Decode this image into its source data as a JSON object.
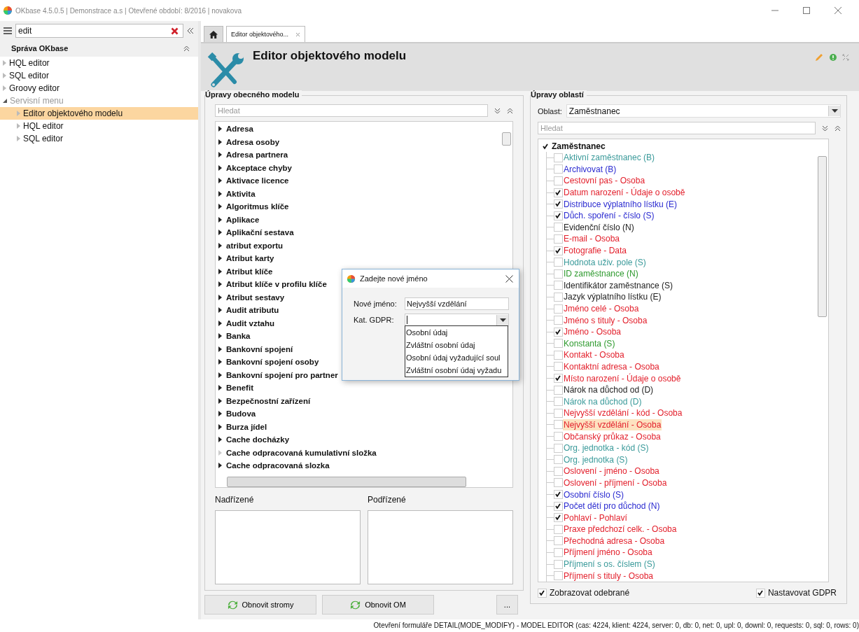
{
  "window": {
    "title": "OKbase 4.5.0.5 | Demonstrace a.s | Otevřené období: 8/2016 | novakova"
  },
  "sidebar": {
    "search": {
      "value": "edit"
    },
    "section": "Správa OKbase",
    "items": [
      {
        "label": "HQL editor",
        "expanded": false,
        "selected": false,
        "disabled": false
      },
      {
        "label": "SQL editor",
        "expanded": false,
        "selected": false,
        "disabled": false
      },
      {
        "label": "Groovy editor",
        "expanded": false,
        "selected": false,
        "disabled": false
      },
      {
        "label": "Servisní menu",
        "expanded": true,
        "selected": false,
        "disabled": true,
        "children": [
          {
            "label": "Editor objektového modelu",
            "expanded": false,
            "selected": true,
            "disabled": false
          },
          {
            "label": "HQL editor",
            "expanded": false,
            "selected": false,
            "disabled": false
          },
          {
            "label": "SQL editor",
            "expanded": false,
            "selected": false,
            "disabled": false
          }
        ]
      }
    ]
  },
  "tabs": [
    {
      "kind": "home",
      "selected": false
    },
    {
      "kind": "text",
      "label": "Editor objektového...",
      "selected": true
    }
  ],
  "header": {
    "title": "Editor objektového modelu"
  },
  "general_model": {
    "legend": "Úpravy obecného modelu",
    "search": {
      "placeholder": "Hledat"
    },
    "entities": [
      {
        "label": "Adresa",
        "has_children": true
      },
      {
        "label": "Adresa osoby",
        "has_children": true
      },
      {
        "label": "Adresa partnera",
        "has_children": true
      },
      {
        "label": "Akceptace chyby",
        "has_children": true
      },
      {
        "label": "Aktivace licence",
        "has_children": true
      },
      {
        "label": "Aktivita",
        "has_children": true
      },
      {
        "label": "Algoritmus klíče",
        "has_children": true
      },
      {
        "label": "Aplikace",
        "has_children": true
      },
      {
        "label": "Aplikační sestava",
        "has_children": true
      },
      {
        "label": "atribut exportu",
        "has_children": true
      },
      {
        "label": "Atribut karty",
        "has_children": true
      },
      {
        "label": "Atribut klíče",
        "has_children": true
      },
      {
        "label": "Atribut klíče v profilu klíče",
        "has_children": true
      },
      {
        "label": "Atribut sestavy",
        "has_children": true
      },
      {
        "label": "Audit atributu",
        "has_children": true
      },
      {
        "label": "Audit vztahu",
        "has_children": true
      },
      {
        "label": "Banka",
        "has_children": true
      },
      {
        "label": "Bankovní spojení",
        "has_children": true
      },
      {
        "label": "Bankovní spojení osoby",
        "has_children": true
      },
      {
        "label": "Bankovní spojení pro partner",
        "has_children": true
      },
      {
        "label": "Benefit",
        "has_children": true
      },
      {
        "label": "Bezpečnostní zařízení",
        "has_children": true
      },
      {
        "label": "Budova",
        "has_children": true
      },
      {
        "label": "Burza jídel",
        "has_children": true
      },
      {
        "label": "Cache docházky",
        "has_children": true
      },
      {
        "label": "Cache odpracovaná kumulativní složka",
        "has_children": false
      },
      {
        "label": "Cache odpracovaná slozka",
        "has_children": true
      }
    ],
    "parents_label": "Nadřízené",
    "children_label": "Podřízené"
  },
  "buttons": [
    {
      "kind": "refresh",
      "label": "Obnovit stromy"
    },
    {
      "kind": "refresh",
      "label": "Obnovit OM"
    },
    {
      "kind": "plain",
      "label": "..."
    }
  ],
  "areas": {
    "legend": "Úpravy oblastí",
    "area_label": "Oblast:",
    "area_value": "Zaměstnanec",
    "search": {
      "placeholder": "Hledat"
    },
    "root": {
      "label": "Zaměstnanec",
      "checked": true,
      "children": [
        {
          "label": "Aktivní zaměstnanec (B)",
          "checked": false,
          "selected": false,
          "color": "#3a9a9a"
        },
        {
          "label": "Archivovat (B)",
          "checked": false,
          "selected": false,
          "color": "#2a2ad0"
        },
        {
          "label": "Cestovní pas - Osoba",
          "checked": false,
          "selected": false,
          "color": "#e3202c"
        },
        {
          "label": "Datum narození - Údaje o osobě",
          "checked": true,
          "selected": false,
          "color": "#e3202c"
        },
        {
          "label": "Distribuce výplatního lístku (E)",
          "checked": true,
          "selected": false,
          "color": "#2a2ad0"
        },
        {
          "label": "Důch. spoření - číslo (S)",
          "checked": true,
          "selected": false,
          "color": "#2a2ad0"
        },
        {
          "label": "Evidenční číslo (N)",
          "checked": false,
          "selected": false,
          "color": "#222222"
        },
        {
          "label": "E-mail - Osoba",
          "checked": false,
          "selected": false,
          "color": "#e3202c"
        },
        {
          "label": "Fotografie - Data",
          "checked": true,
          "selected": false,
          "color": "#e3202c"
        },
        {
          "label": "Hodnota uživ. pole (S)",
          "checked": false,
          "selected": false,
          "color": "#3a9a9a"
        },
        {
          "label": "ID zaměstnance (N)",
          "checked": false,
          "selected": false,
          "color": "#2e9a2e"
        },
        {
          "label": "Identifikátor zaměstnance (S)",
          "checked": false,
          "selected": false,
          "color": "#222222"
        },
        {
          "label": "Jazyk výplatního lístku (E)",
          "checked": false,
          "selected": false,
          "color": "#222222"
        },
        {
          "label": "Jméno celé - Osoba",
          "checked": false,
          "selected": false,
          "color": "#e3202c"
        },
        {
          "label": "Jméno s tituly - Osoba",
          "checked": false,
          "selected": false,
          "color": "#e3202c"
        },
        {
          "label": "Jméno - Osoba",
          "checked": true,
          "selected": false,
          "color": "#e3202c"
        },
        {
          "label": "Konstanta (S)",
          "checked": false,
          "selected": false,
          "color": "#2e9a2e"
        },
        {
          "label": "Kontakt - Osoba",
          "checked": false,
          "selected": false,
          "color": "#e3202c"
        },
        {
          "label": "Kontaktní adresa - Osoba",
          "checked": false,
          "selected": false,
          "color": "#e3202c"
        },
        {
          "label": "Místo narození - Údaje o osobě",
          "checked": true,
          "selected": false,
          "color": "#e3202c"
        },
        {
          "label": "Nárok na důchod od (D)",
          "checked": false,
          "selected": false,
          "color": "#222222"
        },
        {
          "label": "Nárok na důchod (D)",
          "checked": false,
          "selected": false,
          "color": "#3a9a9a"
        },
        {
          "label": "Nejvyšší vzdělání - kód - Osoba",
          "checked": false,
          "selected": false,
          "color": "#e3202c"
        },
        {
          "label": "Nejvyšší vzdělání - Osoba",
          "checked": false,
          "selected": true,
          "color": "#e3202c"
        },
        {
          "label": "Občanský průkaz - Osoba",
          "checked": false,
          "selected": false,
          "color": "#e3202c"
        },
        {
          "label": "Org. jednotka - kód (S)",
          "checked": false,
          "selected": false,
          "color": "#3a9a9a"
        },
        {
          "label": "Org. jednotka (S)",
          "checked": false,
          "selected": false,
          "color": "#3a9a9a"
        },
        {
          "label": "Oslovení - jméno - Osoba",
          "checked": false,
          "selected": false,
          "color": "#e3202c"
        },
        {
          "label": "Oslovení - příjmení - Osoba",
          "checked": false,
          "selected": false,
          "color": "#e3202c"
        },
        {
          "label": "Osobní číslo (S)",
          "checked": true,
          "selected": false,
          "color": "#2a2ad0"
        },
        {
          "label": "Počet dětí pro důchod (N)",
          "checked": true,
          "selected": false,
          "color": "#2a2ad0"
        },
        {
          "label": "Pohlaví - Pohlaví",
          "checked": true,
          "selected": false,
          "color": "#e3202c"
        },
        {
          "label": "Praxe předchozí celk. - Osoba",
          "checked": false,
          "selected": false,
          "color": "#e3202c"
        },
        {
          "label": "Přechodná adresa - Osoba",
          "checked": false,
          "selected": false,
          "color": "#e3202c"
        },
        {
          "label": "Příjmení jméno - Osoba",
          "checked": false,
          "selected": false,
          "color": "#e3202c"
        },
        {
          "label": "Příjmení s os. číslem (S)",
          "checked": false,
          "selected": false,
          "color": "#3a9a9a"
        },
        {
          "label": "Příjmení s tituly - Osoba",
          "checked": false,
          "selected": false,
          "color": "#e3202c"
        }
      ]
    },
    "options": [
      {
        "label": "Zobrazovat odebrané",
        "checked": true
      },
      {
        "label": "Nastavovat GDPR",
        "checked": true
      }
    ]
  },
  "dialog": {
    "title": "Zadejte nové jméno",
    "name_label": "Nové jméno:",
    "name_value": "Nejvyšší vzdělání",
    "gdpr_label": "Kat. GDPR:",
    "options": [
      "Osobní údaj",
      "Zvláštní osobní údaj",
      "Osobní údaj vyžadující soul",
      "Zvláštní osobní údaj vyžadu"
    ]
  },
  "status_bar": "Otevření formuláře DETAIL(MODE_MODIFY) - MODEL EDITOR (cas: 4224, klient: 4224, server: 0, db: 0, net: 0, upl: 0, downl: 0, requests: 0, sql: 0, rows: 0)"
}
